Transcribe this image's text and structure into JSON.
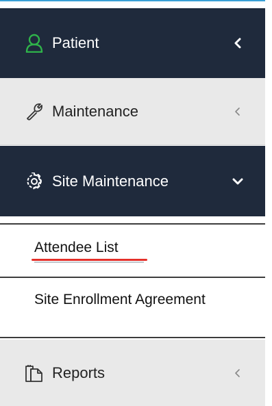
{
  "sidebar": {
    "patient": {
      "label": "Patient",
      "icon": "user-icon",
      "chevron": "chevron-left-icon"
    },
    "maintenance": {
      "label": "Maintenance",
      "icon": "wrench-icon",
      "chevron": "chevron-left-icon"
    },
    "site_maintenance": {
      "label": "Site Maintenance",
      "icon": "gear-icon",
      "chevron": "chevron-down-icon",
      "subitems": [
        {
          "label": "Attendee List"
        },
        {
          "label": "Site Enrollment Agreement"
        }
      ]
    },
    "reports": {
      "label": "Reports",
      "icon": "documents-icon",
      "chevron": "chevron-left-icon"
    }
  },
  "colors": {
    "dark_bg": "#1f2a3c",
    "light_bg": "#e9e9e9",
    "accent_green": "#2fb34a",
    "underline_red": "#e4302a"
  }
}
